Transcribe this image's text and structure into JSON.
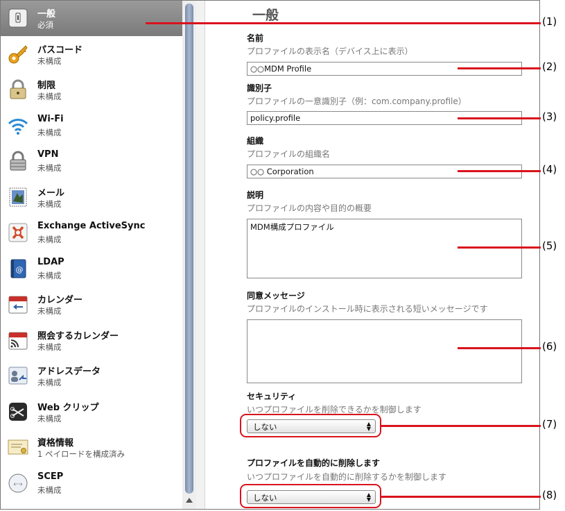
{
  "sidebar": {
    "items": [
      {
        "title": "一般",
        "subtitle": "必須",
        "icon": "general-icon"
      },
      {
        "title": "パスコード",
        "subtitle": "未構成",
        "icon": "key-icon"
      },
      {
        "title": "制限",
        "subtitle": "未構成",
        "icon": "lock-icon"
      },
      {
        "title": "Wi-Fi",
        "subtitle": "未構成",
        "icon": "wifi-icon"
      },
      {
        "title": "VPN",
        "subtitle": "未構成",
        "icon": "vpn-lock-icon"
      },
      {
        "title": "メール",
        "subtitle": "未構成",
        "icon": "mail-stamp-icon"
      },
      {
        "title": "Exchange ActiveSync",
        "subtitle": "未構成",
        "icon": "exchange-icon"
      },
      {
        "title": "LDAP",
        "subtitle": "未構成",
        "icon": "ldap-book-icon"
      },
      {
        "title": "カレンダー",
        "subtitle": "未構成",
        "icon": "calendar-icon"
      },
      {
        "title": "照会するカレンダー",
        "subtitle": "未構成",
        "icon": "subscribed-calendar-icon"
      },
      {
        "title": "アドレスデータ",
        "subtitle": "未構成",
        "icon": "contacts-icon"
      },
      {
        "title": "Web クリップ",
        "subtitle": "未構成",
        "icon": "web-clip-icon"
      },
      {
        "title": "資格情報",
        "subtitle": "1 ペイロードを構成済み",
        "icon": "certificate-icon"
      },
      {
        "title": "SCEP",
        "subtitle": "未構成",
        "icon": "scep-icon"
      }
    ]
  },
  "main": {
    "title": "一般",
    "name": {
      "label": "名前",
      "description": "プロファイルの表示名（デバイス上に表示）",
      "value": "○○MDM Profile"
    },
    "identifier": {
      "label": "識別子",
      "description": "プロファイルの一意識別子（例：com.company.profile）",
      "value": "policy.profile"
    },
    "organization": {
      "label": "組織",
      "description": "プロファイルの組織名",
      "value": "○○ Corporation"
    },
    "description": {
      "label": "説明",
      "description": "プロファイルの内容や目的の概要",
      "value": "MDM構成プロファイル"
    },
    "consent": {
      "label": "同意メッセージ",
      "description": "プロファイルのインストール時に表示される短いメッセージです",
      "value": ""
    },
    "security": {
      "label": "セキュリティ",
      "description": "いつプロファイルを削除できるかを制御します",
      "selected": "しない"
    },
    "auto_remove": {
      "label": "プロファイルを自動的に削除します",
      "description": "いつプロファイルを自動的に削除するかを制御します",
      "selected": "しない"
    }
  },
  "callouts": [
    "(1)",
    "(2)",
    "(3)",
    "(4)",
    "(5)",
    "(6)",
    "(7)",
    "(8)"
  ],
  "colors": {
    "highlight": "#d9131d",
    "selected_row": "#8a8a8a",
    "scroll_thumb": "#8fa0bc"
  }
}
